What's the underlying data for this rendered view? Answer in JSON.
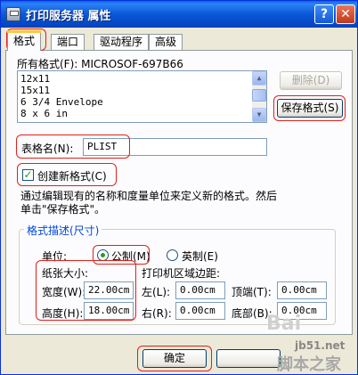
{
  "window": {
    "title": "打印服务器 属性",
    "help_label": "?",
    "close_label": "✕"
  },
  "tabs": [
    {
      "label": "格式",
      "active": true
    },
    {
      "label": "端口"
    },
    {
      "label": "驱动程序"
    },
    {
      "label": "高级"
    }
  ],
  "formats": {
    "label": "所有格式(F): MICROSOF-697B66",
    "items": [
      "12x11",
      "15x11",
      "6 3/4 Envelope",
      "8 x 6 in"
    ],
    "delete_label": "删除(D)",
    "save_label": "保存格式(S)"
  },
  "form": {
    "name_label": "表格名(N):",
    "name_value": "PLIST",
    "create_label": "创建新格式(C)",
    "create_checked": true,
    "hint": "通过编辑现有的名称和度量单位来定义新的格式。然后单击\"保存格式\"。"
  },
  "description": {
    "title": "格式描述(尺寸)",
    "unit_label": "单位:",
    "metric_label": "公制(M)",
    "imperial_label": "英制(E)",
    "paper_size_label": "纸张大小:",
    "margins_label": "打印机区域边距:",
    "width_label": "宽度(W):",
    "width_value": "22.00cm",
    "height_label": "高度(H):",
    "height_value": "18.00cm",
    "left_label": "左(L):",
    "left_value": "0.00cm",
    "right_label": "右(R):",
    "right_value": "0.00cm",
    "top_label": "顶端(T):",
    "top_value": "0.00cm",
    "bottom_label": "底部(B):",
    "bottom_value": "0.00cm"
  },
  "footer": {
    "ok_label": "确定"
  },
  "watermark": {
    "site": "jb51.net",
    "brand": "脚本之家",
    "baidu": "Bai"
  }
}
